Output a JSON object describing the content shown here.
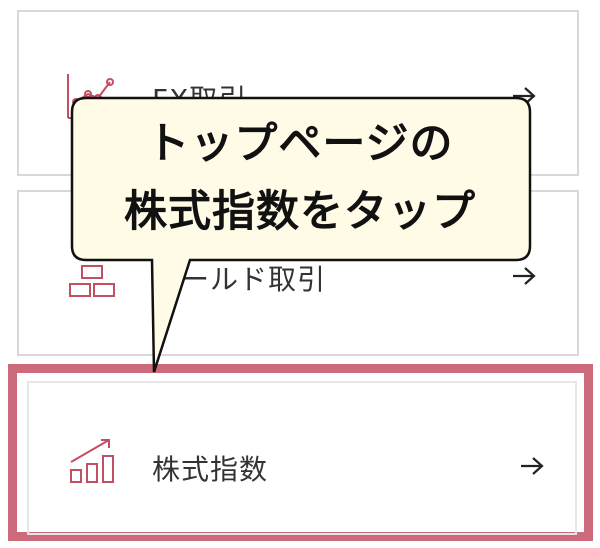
{
  "menu": {
    "items": [
      {
        "label": "FX取引",
        "icon": "chart-line-icon"
      },
      {
        "label": "ゴールド取引",
        "icon": "gold-bars-icon"
      },
      {
        "label": "株式指数",
        "icon": "bar-chart-up-icon"
      }
    ],
    "arrow_icon": "arrow-right-icon"
  },
  "callout": {
    "line1": "トップページの",
    "line2": "株式指数をタップ"
  },
  "colors": {
    "accent": "#cc6a7b",
    "callout_bg": "#fffbe6",
    "border": "#d8d8d8"
  }
}
